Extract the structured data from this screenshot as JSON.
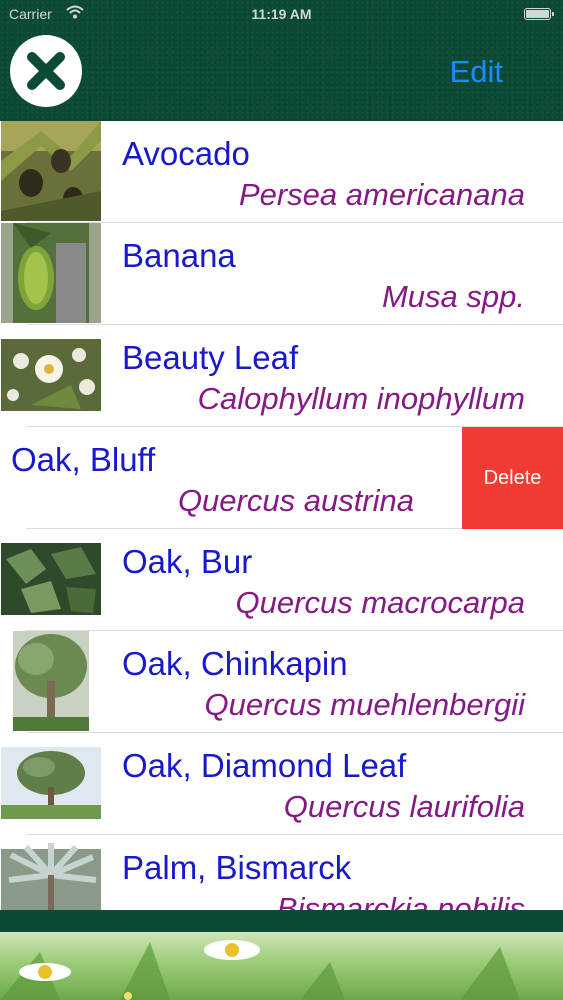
{
  "status_bar": {
    "carrier": "Carrier",
    "time": "11:19 AM",
    "wifi_icon": "wifi-icon",
    "battery_icon": "battery-icon"
  },
  "header": {
    "close_icon": "close-x-icon",
    "edit_label": "Edit"
  },
  "plants": [
    {
      "common": "Avocado",
      "scientific": "Persea americanana",
      "thumb": "avocado-photo"
    },
    {
      "common": "Banana",
      "scientific": "Musa spp.",
      "thumb": "banana-photo"
    },
    {
      "common": "Beauty Leaf",
      "scientific": "Calophyllum inophyllum",
      "thumb": "beauty-leaf-photo"
    },
    {
      "common": "Oak, Bluff",
      "scientific": "Quercus austrina",
      "swiped": true,
      "delete_label": "Delete"
    },
    {
      "common": "Oak, Bur",
      "scientific": "Quercus macrocarpa",
      "thumb": "oak-bur-photo"
    },
    {
      "common": "Oak, Chinkapin",
      "scientific": "Quercus muehlenbergii",
      "thumb": "oak-chinkapin-photo"
    },
    {
      "common": "Oak, Diamond Leaf",
      "scientific": "Quercus laurifolia",
      "thumb": "oak-diamond-leaf-photo"
    },
    {
      "common": "Palm, Bismarck",
      "scientific": "Bismarckia nobilis",
      "thumb": "palm-bismarck-photo"
    }
  ],
  "colors": {
    "header_green": "#0d4a35",
    "common_name": "#1818cc",
    "scientific_name": "#851a85",
    "edit_blue": "#1a8cff",
    "delete_red": "#f23b33"
  }
}
